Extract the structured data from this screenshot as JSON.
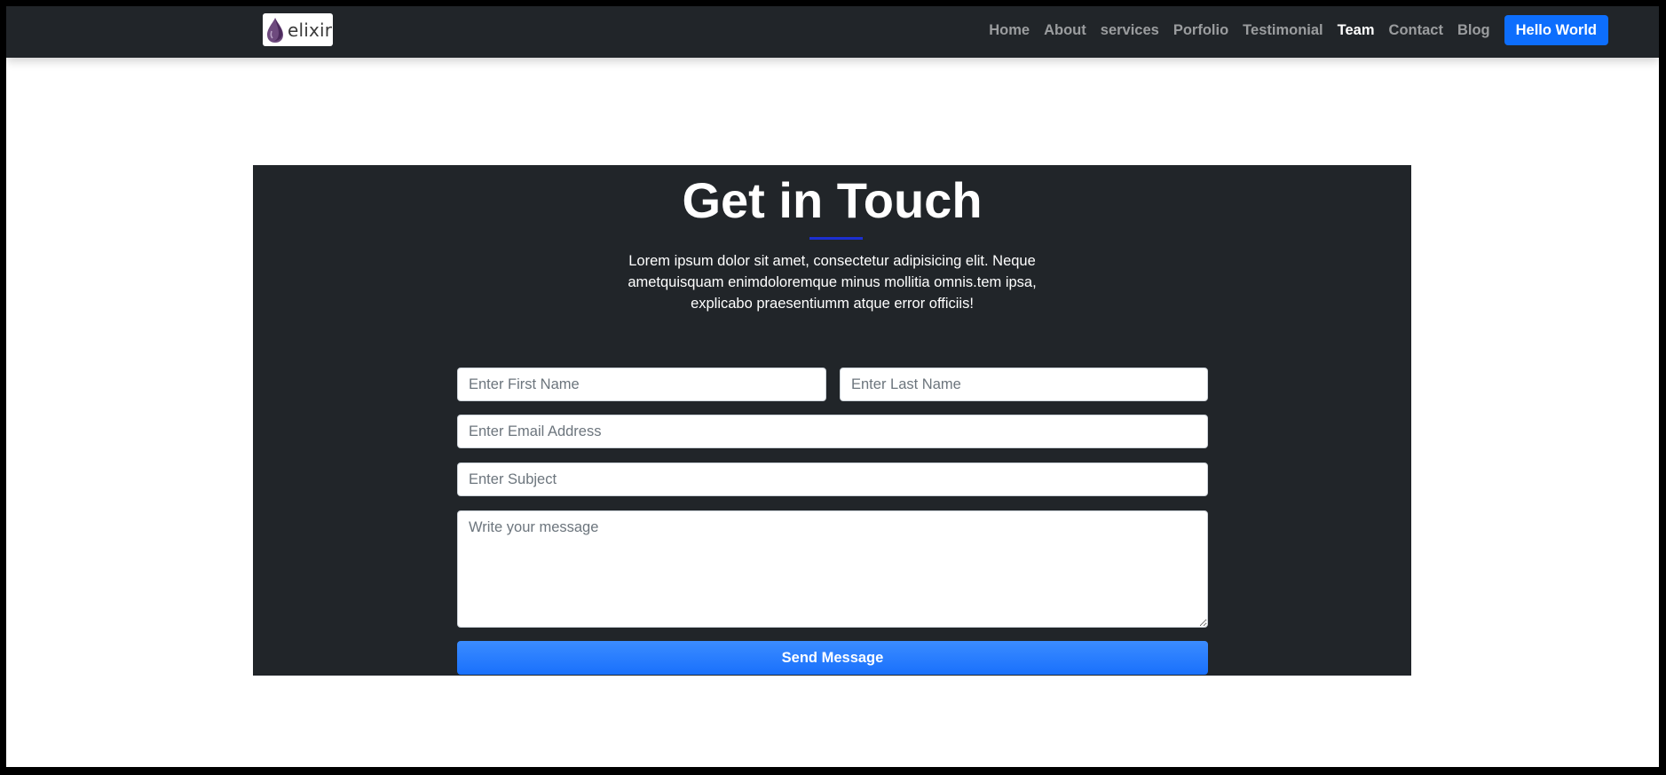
{
  "navbar": {
    "logo": {
      "text": "elixir",
      "icon": "elixir-drop-icon"
    },
    "links": [
      {
        "label": "Home",
        "active": false
      },
      {
        "label": "About",
        "active": false
      },
      {
        "label": "services",
        "active": false
      },
      {
        "label": "Porfolio",
        "active": false
      },
      {
        "label": "Testimonial",
        "active": false
      },
      {
        "label": "Team",
        "active": true
      },
      {
        "label": "Contact",
        "active": false
      },
      {
        "label": "Blog",
        "active": false
      }
    ],
    "cta_label": "Hello World"
  },
  "contact": {
    "title": "Get in Touch",
    "description": "Lorem ipsum dolor sit amet, consectetur adipisicing elit. Neque ametquisquam enimdoloremque minus mollitia omnis.tem ipsa, explicabo praesentiumm atque error officiis!",
    "form": {
      "first_name": {
        "value": "",
        "placeholder": "Enter First Name"
      },
      "last_name": {
        "value": "",
        "placeholder": "Enter Last Name"
      },
      "email": {
        "value": "",
        "placeholder": "Enter Email Address"
      },
      "subject": {
        "value": "",
        "placeholder": "Enter Subject"
      },
      "message": {
        "value": "",
        "placeholder": "Write your message"
      },
      "submit_label": "Send Message"
    }
  },
  "colors": {
    "navbar_bg": "#212529",
    "section_bg": "#212529",
    "primary": "#0d6efd",
    "title_underline": "#1c2fd1",
    "page_bg": "#ffffff",
    "frame": "#000000"
  }
}
